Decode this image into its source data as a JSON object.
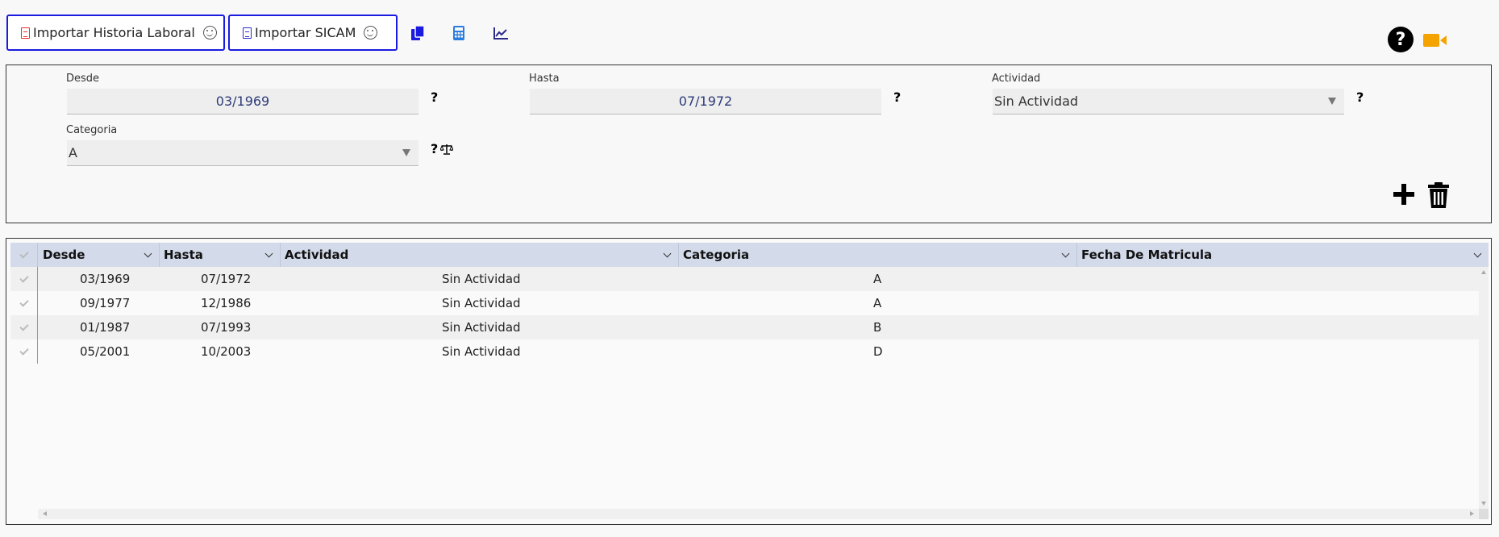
{
  "toolbar": {
    "import_historia_label": "Importar Historia Laboral",
    "import_sicam_label": "Importar SICAM",
    "icons": [
      "copy-icon",
      "calculator-icon",
      "chart-icon",
      "help-icon",
      "video-icon"
    ],
    "colors": {
      "button_border": "#1a1ae0",
      "pdf_red": "#e03030",
      "pdf_blue": "#2a2ad0",
      "video": "#f5a300"
    },
    "help_label": "?"
  },
  "form": {
    "desde": {
      "label": "Desde",
      "value": "03/1969"
    },
    "hasta": {
      "label": "Hasta",
      "value": "07/1972"
    },
    "actividad": {
      "label": "Actividad",
      "value": "Sin Actividad"
    },
    "categoria": {
      "label": "Categoria",
      "value": "A"
    },
    "help_mark": "?"
  },
  "grid": {
    "columns": [
      "Desde",
      "Hasta",
      "Actividad",
      "Categoria",
      "Fecha De Matricula"
    ],
    "rows": [
      {
        "desde": "03/1969",
        "hasta": "07/1972",
        "actividad": "Sin Actividad",
        "categoria": "A",
        "fecha": ""
      },
      {
        "desde": "09/1977",
        "hasta": "12/1986",
        "actividad": "Sin Actividad",
        "categoria": "A",
        "fecha": ""
      },
      {
        "desde": "01/1987",
        "hasta": "07/1993",
        "actividad": "Sin Actividad",
        "categoria": "B",
        "fecha": ""
      },
      {
        "desde": "05/2001",
        "hasta": "10/2003",
        "actividad": "Sin Actividad",
        "categoria": "D",
        "fecha": ""
      }
    ]
  }
}
